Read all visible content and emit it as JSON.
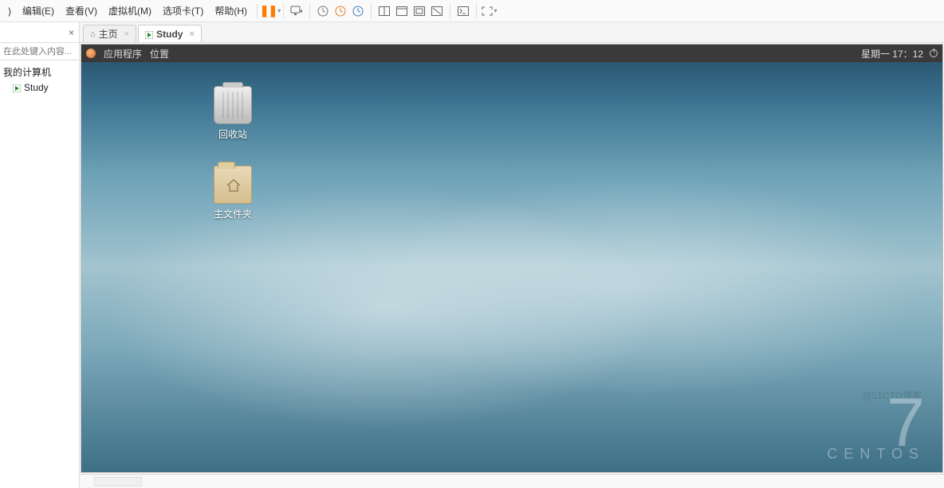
{
  "menubar": {
    "items": [
      ")",
      "编辑(E)",
      "查看(V)",
      "虚拟机(M)",
      "选项卡(T)",
      "帮助(H)"
    ]
  },
  "sidebar": {
    "search_placeholder": "在此处键入内容...",
    "root_label": "我的计算机",
    "vm_label": "Study"
  },
  "tabs": {
    "home": "主页",
    "vm": "Study"
  },
  "guest_bar": {
    "apps": "应用程序",
    "places": "位置",
    "clock": "星期一 17：12"
  },
  "desktop": {
    "trash_label": "回收站",
    "home_label": "主文件夹",
    "brand_num": "7",
    "brand_text": "CENTOS",
    "blog_wm": "@51CTO博客"
  }
}
